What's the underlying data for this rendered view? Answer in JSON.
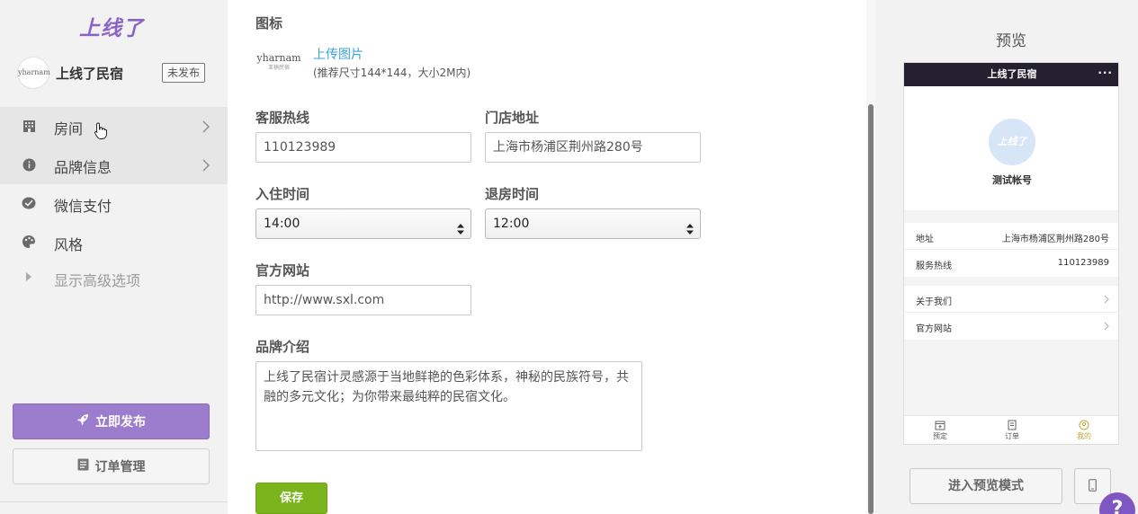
{
  "sidebar": {
    "logo": "上线了",
    "shop": {
      "avatar_text": "yharnam",
      "name": "上线了民宿",
      "status": "未发布"
    },
    "items": [
      {
        "label": "房间",
        "icon": "building-icon"
      },
      {
        "label": "品牌信息",
        "icon": "info-icon"
      },
      {
        "label": "微信支付",
        "icon": "wechat-pay-icon"
      },
      {
        "label": "风格",
        "icon": "palette-icon"
      },
      {
        "label": "显示高级选项",
        "icon": "caret-right-icon"
      }
    ],
    "publish_label": "立即发布",
    "orders_label": "订单管理"
  },
  "form": {
    "icon_label": "图标",
    "logo_text": "yharnam",
    "logo_subtext": "亚楠民宿",
    "upload_link": "上传图片",
    "upload_hint": "(推荐尺寸144*144，大小2M内)",
    "hotline_label": "客服热线",
    "hotline_value": "110123989",
    "address_label": "门店地址",
    "address_value": "上海市杨浦区荆州路280号",
    "checkin_label": "入住时间",
    "checkin_value": "14:00",
    "checkout_label": "退房时间",
    "checkout_value": "12:00",
    "website_label": "官方网站",
    "website_value": "http://www.sxl.com",
    "intro_label": "品牌介绍",
    "intro_value": "上线了民宿计灵感源于当地鲜艳的色彩体系，神秘的民族符号，共融的多元文化；为你带来最纯粹的民宿文化。",
    "save_label": "保存"
  },
  "preview": {
    "title": "预览",
    "phone": {
      "header_title": "上线了民宿",
      "more": "···",
      "avatar_text": "上线了",
      "account": "测试帐号",
      "info_rows": [
        {
          "key": "地址",
          "value": "上海市杨浦区荆州路280号"
        },
        {
          "key": "服务热线",
          "value": "110123989"
        }
      ],
      "link_rows": [
        {
          "key": "关于我们"
        },
        {
          "key": "官方网站"
        }
      ],
      "tabs": [
        {
          "label": "预定"
        },
        {
          "label": "订单"
        },
        {
          "label": "我的"
        }
      ]
    },
    "preview_mode_label": "进入预览模式",
    "help": "?"
  },
  "colors": {
    "brand_purple": "#8b63c6",
    "publish_button": "#9b7ccd",
    "save_green": "#7ab51d",
    "link_blue": "#39a2db",
    "phone_header": "#24202f"
  }
}
